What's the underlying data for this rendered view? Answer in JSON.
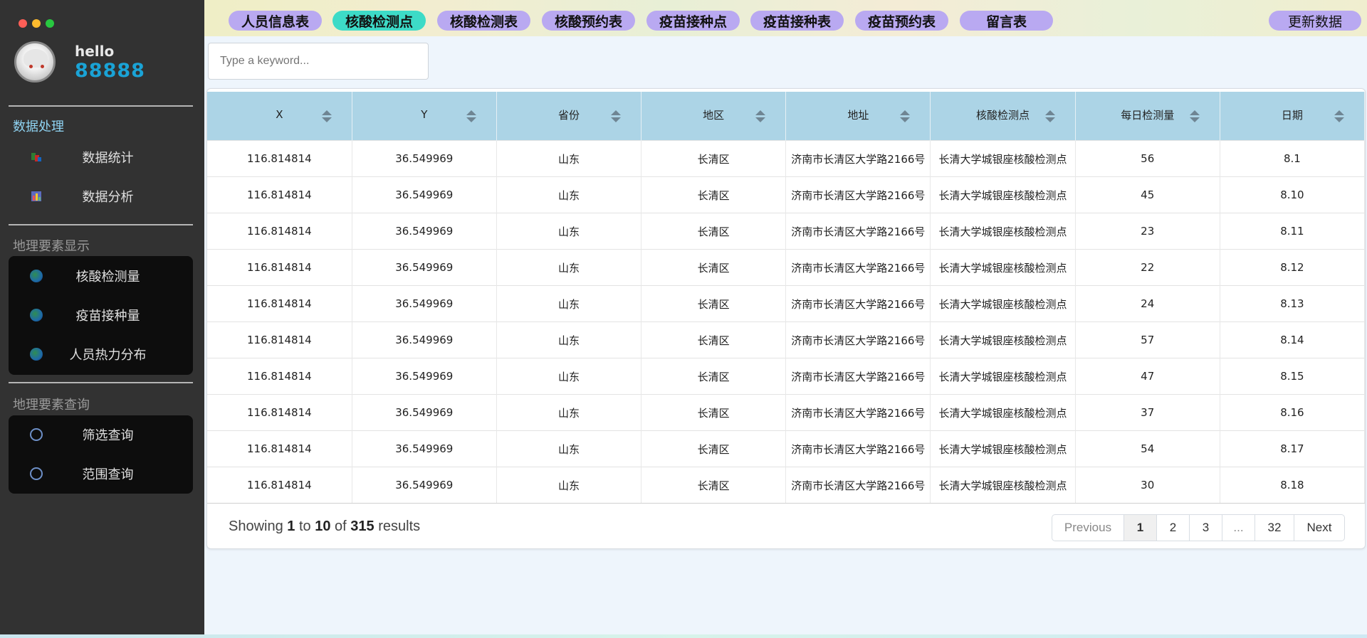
{
  "window": {
    "controls": [
      "#ff5f57",
      "#febc2e",
      "#28c840"
    ]
  },
  "user": {
    "greeting": "hello",
    "id": "88888"
  },
  "sidebar": {
    "section1": {
      "title": "数据处理",
      "items": [
        {
          "label": "数据统计",
          "icon": "stats-chart-icon"
        },
        {
          "label": "数据分析",
          "icon": "analysis-chart-icon"
        }
      ]
    },
    "section2": {
      "title": "地理要素显示",
      "items": [
        {
          "label": "核酸检测量",
          "icon": "globe-icon"
        },
        {
          "label": "疫苗接种量",
          "icon": "globe-icon"
        },
        {
          "label": "人员热力分布",
          "icon": "globe-icon"
        }
      ]
    },
    "section3": {
      "title": "地理要素查询",
      "items": [
        {
          "label": "筛选查询",
          "icon": "network-globe-icon"
        },
        {
          "label": "范围查询",
          "icon": "network-globe-icon"
        }
      ]
    }
  },
  "tabs": [
    "人员信息表",
    "核酸检测点",
    "核酸检测表",
    "核酸预约表",
    "疫苗接种点",
    "疫苗接种表",
    "疫苗预约表",
    "留言表"
  ],
  "active_tab": "核酸检测点",
  "update_button": "更新数据",
  "search": {
    "placeholder": "Type a keyword..."
  },
  "table": {
    "columns": [
      "X",
      "Y",
      "省份",
      "地区",
      "地址",
      "核酸检测点",
      "每日检测量",
      "日期"
    ],
    "rows": [
      [
        "116.814814",
        "36.549969",
        "山东",
        "长清区",
        "济南市长清区大学路2166号",
        "长清大学城银座核酸检测点",
        "56",
        "8.1"
      ],
      [
        "116.814814",
        "36.549969",
        "山东",
        "长清区",
        "济南市长清区大学路2166号",
        "长清大学城银座核酸检测点",
        "45",
        "8.10"
      ],
      [
        "116.814814",
        "36.549969",
        "山东",
        "长清区",
        "济南市长清区大学路2166号",
        "长清大学城银座核酸检测点",
        "23",
        "8.11"
      ],
      [
        "116.814814",
        "36.549969",
        "山东",
        "长清区",
        "济南市长清区大学路2166号",
        "长清大学城银座核酸检测点",
        "22",
        "8.12"
      ],
      [
        "116.814814",
        "36.549969",
        "山东",
        "长清区",
        "济南市长清区大学路2166号",
        "长清大学城银座核酸检测点",
        "24",
        "8.13"
      ],
      [
        "116.814814",
        "36.549969",
        "山东",
        "长清区",
        "济南市长清区大学路2166号",
        "长清大学城银座核酸检测点",
        "57",
        "8.14"
      ],
      [
        "116.814814",
        "36.549969",
        "山东",
        "长清区",
        "济南市长清区大学路2166号",
        "长清大学城银座核酸检测点",
        "47",
        "8.15"
      ],
      [
        "116.814814",
        "36.549969",
        "山东",
        "长清区",
        "济南市长清区大学路2166号",
        "长清大学城银座核酸检测点",
        "37",
        "8.16"
      ],
      [
        "116.814814",
        "36.549969",
        "山东",
        "长清区",
        "济南市长清区大学路2166号",
        "长清大学城银座核酸检测点",
        "54",
        "8.17"
      ],
      [
        "116.814814",
        "36.549969",
        "山东",
        "长清区",
        "济南市长清区大学路2166号",
        "长清大学城银座核酸检测点",
        "30",
        "8.18"
      ]
    ]
  },
  "footer": {
    "showing": "Showing",
    "from": "1",
    "to_word": "to",
    "to": "10",
    "of_word": "of",
    "total": "315",
    "results": "results"
  },
  "pagination": {
    "previous": "Previous",
    "pages": [
      "1",
      "2",
      "3",
      "...",
      "32"
    ],
    "current": "1",
    "next": "Next"
  },
  "colors": {
    "sidebar_bg": "#323232",
    "accent": "#1aa3d6",
    "tab": "#b9a9f1",
    "tab_active": "#3ddbc7",
    "header_bg": "#acd4e6"
  }
}
